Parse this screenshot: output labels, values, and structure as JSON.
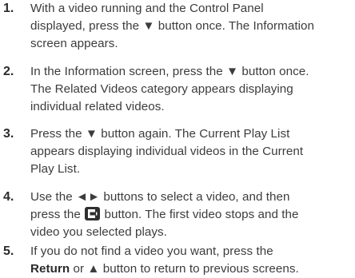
{
  "steps": [
    {
      "number": "1.",
      "lines": [
        "With a video running and the Control Panel",
        "displayed, press the ▼ button once. The Information",
        "screen appears."
      ]
    },
    {
      "number": "2.",
      "lines": [
        "In the Information screen, press the ▼ button once.",
        "The Related Videos category appears displaying",
        "individual related videos."
      ]
    },
    {
      "number": "3.",
      "lines": [
        "Press the ▼ button again. The Current Play List",
        "appears displaying individual videos in the Current",
        "Play List."
      ]
    },
    {
      "number": "4.",
      "line1": "Use the ◄► buttons to select a video, and then",
      "line2_before": "press the",
      "line2_after": "button. The first video stops and the",
      "line3": "video you selected plays.",
      "icon": "enter-button-icon"
    },
    {
      "number": "5.",
      "line1": "If you do not find a video you want, press the",
      "line2_bold": "Return",
      "line2_after": " or ▲ button to return to previous screens."
    }
  ]
}
